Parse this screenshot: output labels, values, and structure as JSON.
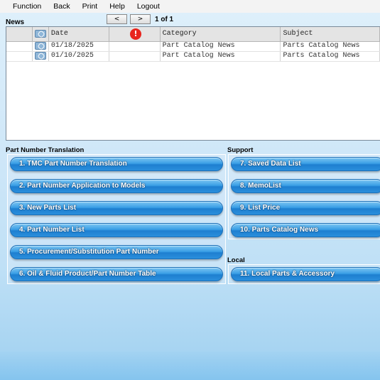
{
  "menu": [
    "Function",
    "Back",
    "Print",
    "Help",
    "Logout"
  ],
  "news": {
    "label": "News",
    "pager": {
      "prev": "<",
      "next": ">",
      "info": "1 of 1"
    },
    "columns": {
      "date": "Date",
      "category": "Category",
      "subject": "Subject"
    },
    "rows": [
      {
        "date": "01/18/2025",
        "category": "Part Catalog News",
        "subject": "Parts Catalog News"
      },
      {
        "date": "01/10/2025",
        "category": "Part Catalog News",
        "subject": "Parts Catalog News"
      }
    ]
  },
  "translation": {
    "label": "Part Number Translation",
    "buttons": [
      "1. TMC Part Number Translation",
      "2. Part Number Application to Models",
      "3. New Parts List",
      "4. Part Number List",
      "5. Procurement/Substitution Part Number",
      "6. Oil & Fluid Product/Part Number Table"
    ]
  },
  "support": {
    "label": "Support",
    "buttons": [
      "7. Saved Data List",
      "8. MemoList",
      "9. List Price",
      "10. Parts Catalog News"
    ]
  },
  "local": {
    "label": "Local",
    "buttons": [
      "11. Local Parts & Accessory"
    ]
  },
  "icons": {
    "attachment": "paperclip-icon",
    "alert": "exclamation-icon"
  },
  "colors": {
    "button": "#2a8fdc",
    "alert": "#e8251d",
    "menubar": "#f3f3f3"
  }
}
